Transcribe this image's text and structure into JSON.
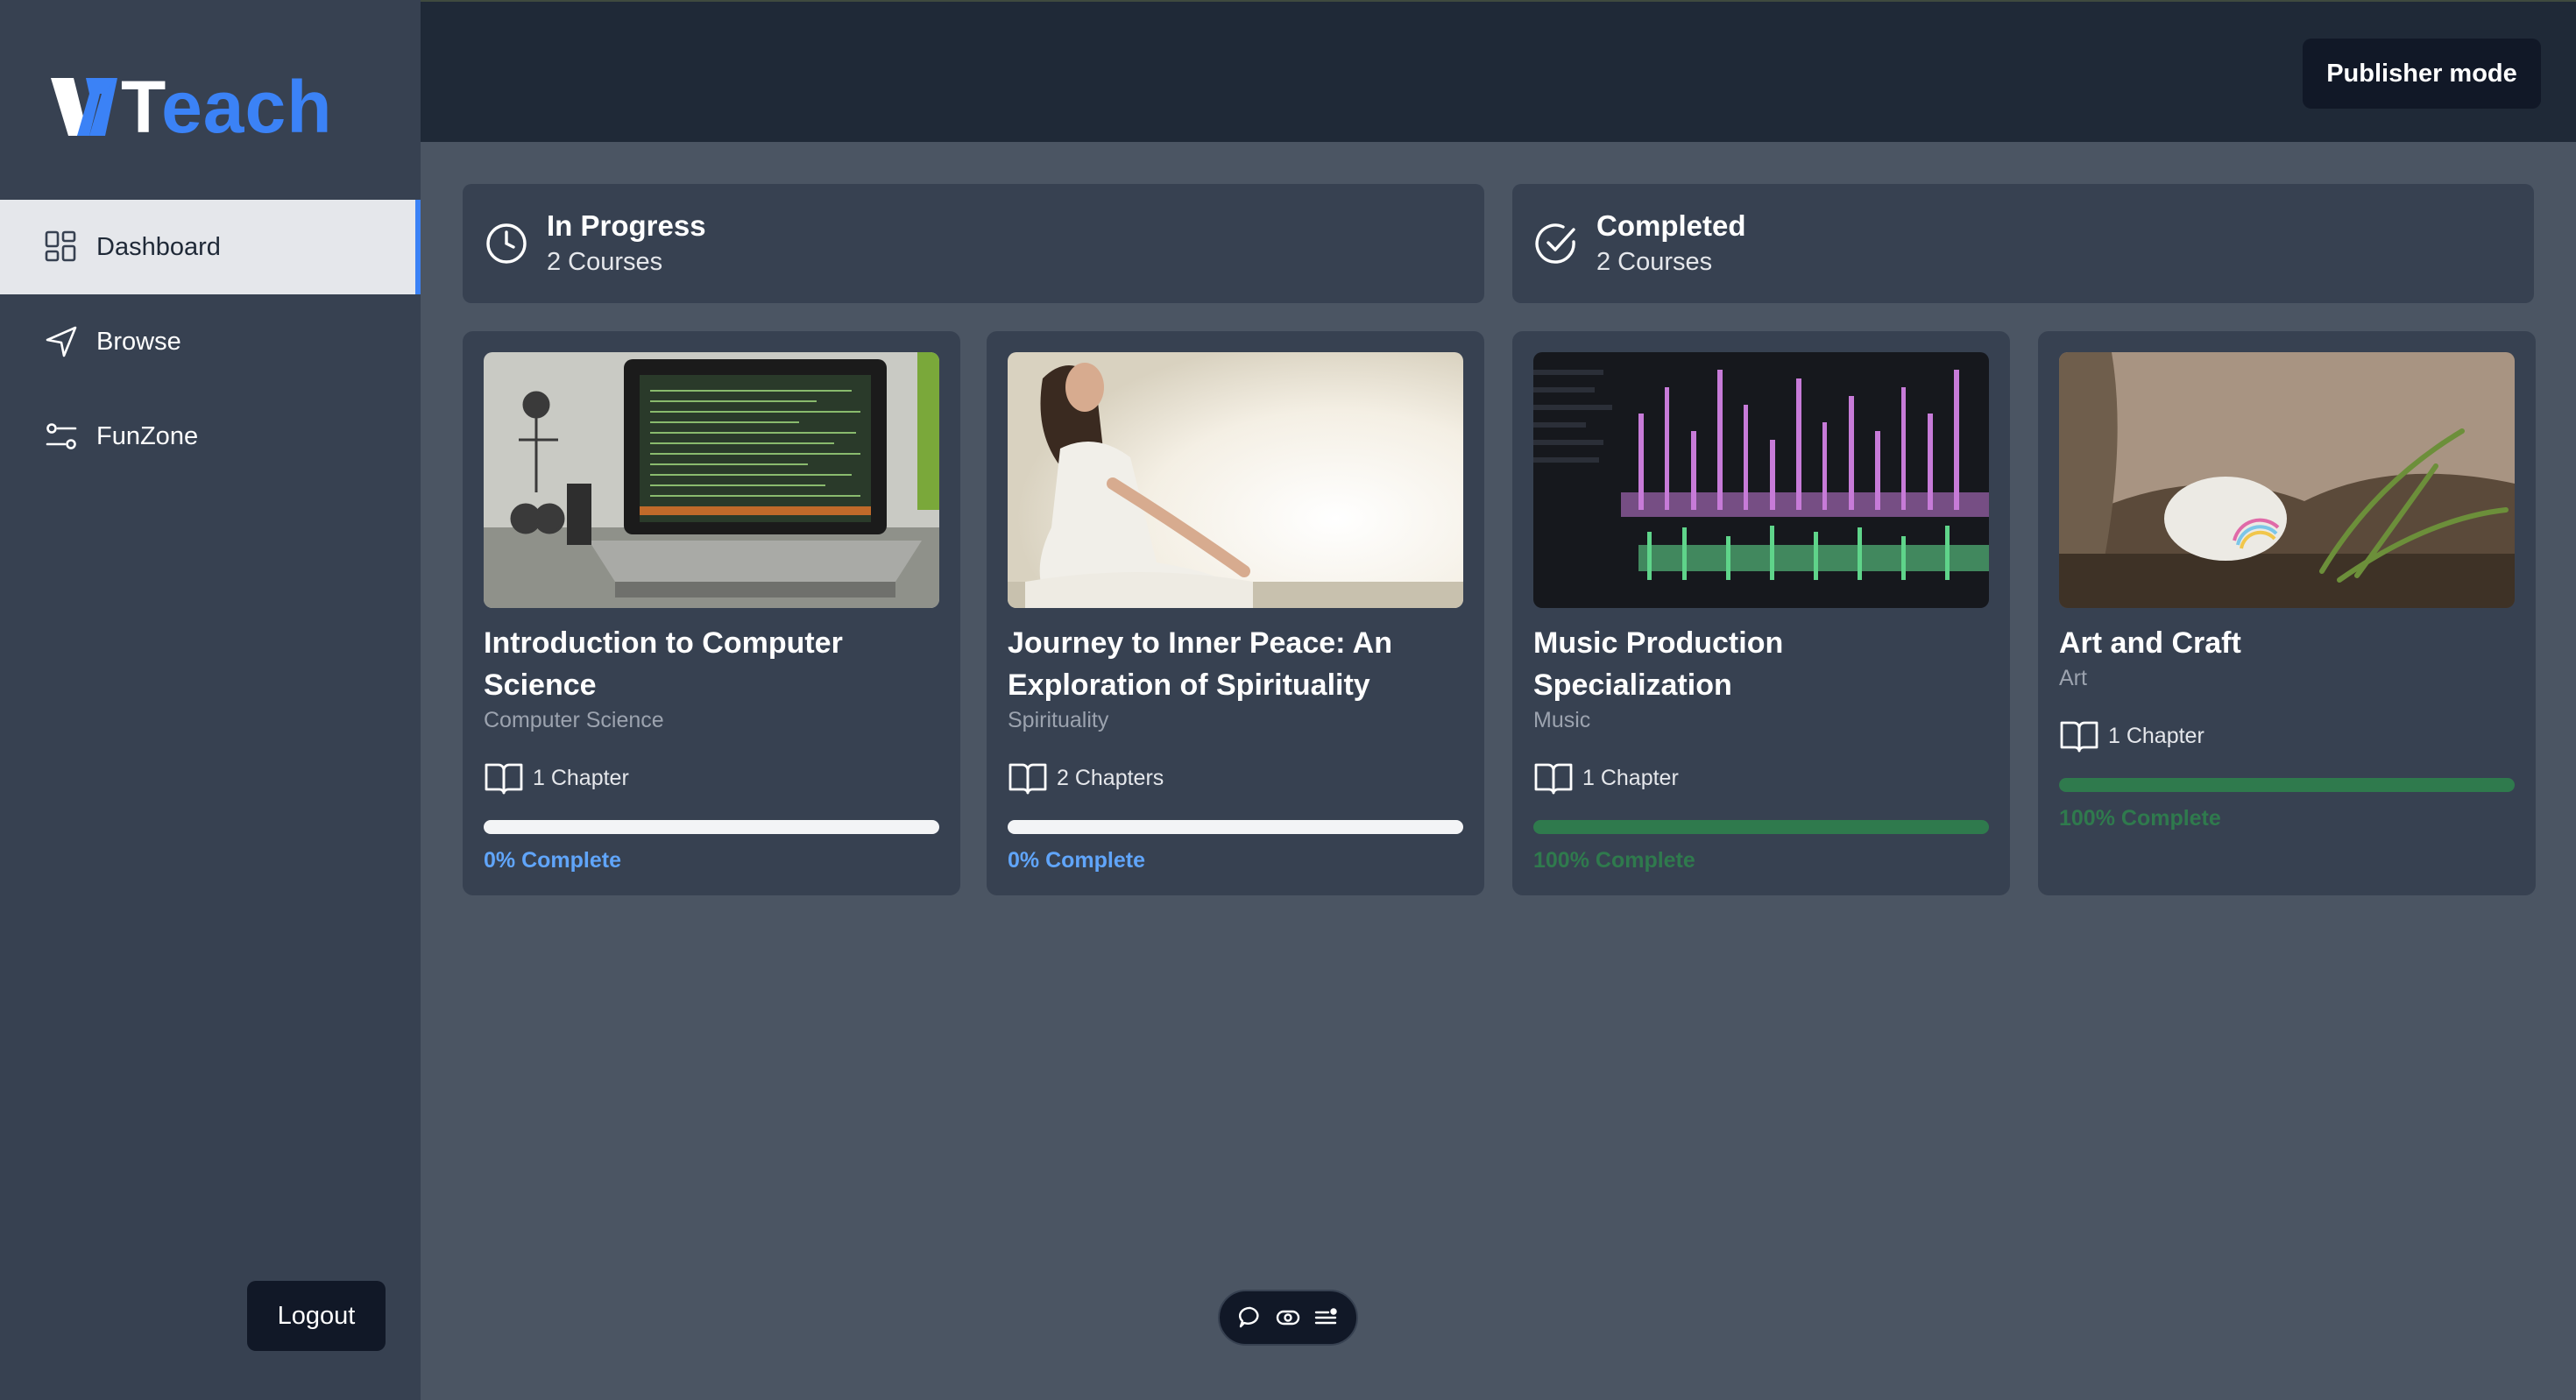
{
  "app": {
    "logo_t": "T",
    "logo_rest": "each"
  },
  "sidebar": {
    "items": [
      {
        "label": "Dashboard",
        "icon": "dashboard-grid-icon",
        "active": true
      },
      {
        "label": "Browse",
        "icon": "send-compass-icon",
        "active": false
      },
      {
        "label": "FunZone",
        "icon": "sliders-icon",
        "active": false
      }
    ],
    "logout_label": "Logout"
  },
  "header": {
    "publisher_label": "Publisher mode"
  },
  "stats": [
    {
      "title": "In Progress",
      "subtitle": "2 Courses",
      "icon": "clock-icon"
    },
    {
      "title": "Completed",
      "subtitle": "2 Courses",
      "icon": "check-circle-icon"
    }
  ],
  "courses": [
    {
      "title": "Introduction to Computer Science",
      "category": "Computer Science",
      "chapters": "1 Chapter",
      "progress": 0,
      "progress_label": "0% Complete"
    },
    {
      "title": "Journey to Inner Peace: An Exploration of Spirituality",
      "category": "Spirituality",
      "chapters": "2 Chapters",
      "progress": 0,
      "progress_label": "0% Complete"
    },
    {
      "title": "Music Production Specialization",
      "category": "Music",
      "chapters": "1 Chapter",
      "progress": 100,
      "progress_label": "100% Complete"
    },
    {
      "title": "Art and Craft",
      "category": "Art",
      "chapters": "1 Chapter",
      "progress": 100,
      "progress_label": "100% Complete"
    }
  ],
  "colors": {
    "accent": "#3b82f6",
    "sidebar_bg": "#374151",
    "topbar_bg": "#1f2937",
    "main_bg": "#4b5563",
    "complete_green": "#2f7a4d",
    "progress_blue": "#60a5fa"
  }
}
